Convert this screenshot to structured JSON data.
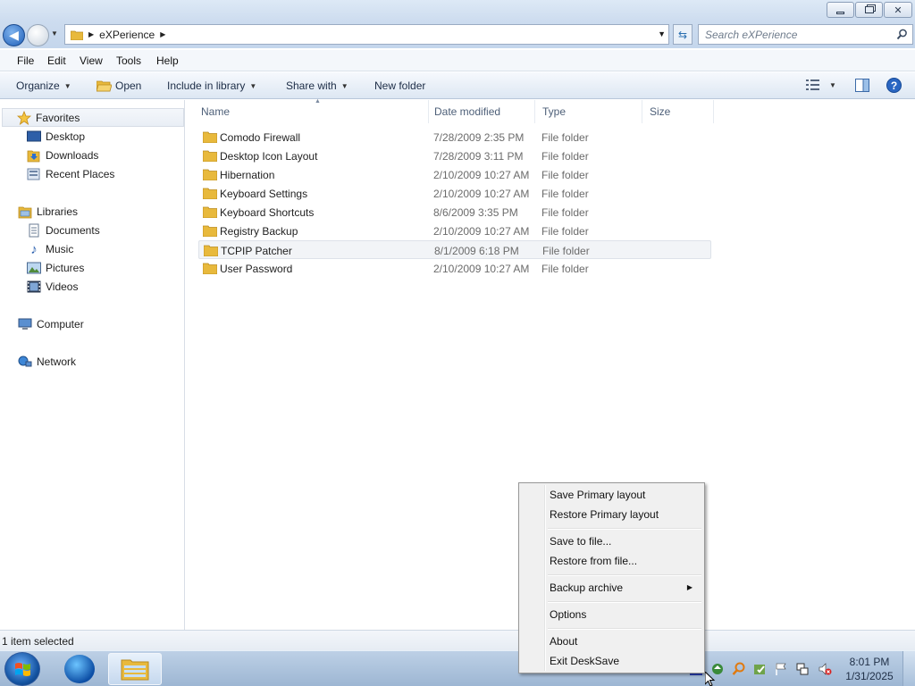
{
  "window": {
    "caption_buttons": {
      "minimize": "▭",
      "maximize": "❐",
      "close": "✕"
    }
  },
  "address": {
    "crumb": "eXPerience",
    "back_icon": "back-arrow-icon",
    "forward_icon": "forward-arrow-icon"
  },
  "search": {
    "placeholder": "Search eXPerience"
  },
  "menu": [
    "File",
    "Edit",
    "View",
    "Tools",
    "Help"
  ],
  "commands": {
    "organize": "Organize",
    "open": "Open",
    "include_in_library": "Include in library",
    "share_with": "Share with",
    "new_folder": "New folder"
  },
  "nav": {
    "favorites": "Favorites",
    "desktop": "Desktop",
    "downloads": "Downloads",
    "recent_places": "Recent Places",
    "libraries": "Libraries",
    "documents": "Documents",
    "music": "Music",
    "pictures": "Pictures",
    "videos": "Videos",
    "computer": "Computer",
    "network": "Network"
  },
  "columns": {
    "name": "Name",
    "date": "Date modified",
    "type": "Type",
    "size": "Size"
  },
  "files": [
    {
      "name": "Comodo Firewall",
      "date": "7/28/2009 2:35 PM",
      "type": "File folder"
    },
    {
      "name": "Desktop Icon Layout",
      "date": "7/28/2009 3:11 PM",
      "type": "File folder"
    },
    {
      "name": "Hibernation",
      "date": "2/10/2009 10:27 AM",
      "type": "File folder"
    },
    {
      "name": "Keyboard Settings",
      "date": "2/10/2009 10:27 AM",
      "type": "File folder"
    },
    {
      "name": "Keyboard Shortcuts",
      "date": "8/6/2009 3:35 PM",
      "type": "File folder"
    },
    {
      "name": "Registry Backup",
      "date": "2/10/2009 10:27 AM",
      "type": "File folder"
    },
    {
      "name": "TCPIP Patcher",
      "date": "8/1/2009 6:18 PM",
      "type": "File folder"
    },
    {
      "name": "User Password",
      "date": "2/10/2009 10:27 AM",
      "type": "File folder"
    }
  ],
  "status": {
    "text": "1 item selected"
  },
  "context_menu": {
    "save_primary": "Save Primary layout",
    "restore_primary": "Restore Primary layout",
    "save_to_file": "Save to file...",
    "restore_from_file": "Restore from file...",
    "backup_archive": "Backup archive",
    "options": "Options",
    "about": "About",
    "exit": "Exit DeskSave"
  },
  "clock": {
    "time": "8:01 PM",
    "date": "1/31/2025"
  },
  "colors": {
    "accent": "#1f5fb8",
    "folder": "#e8b93c",
    "selection": "#f2f4f7"
  }
}
